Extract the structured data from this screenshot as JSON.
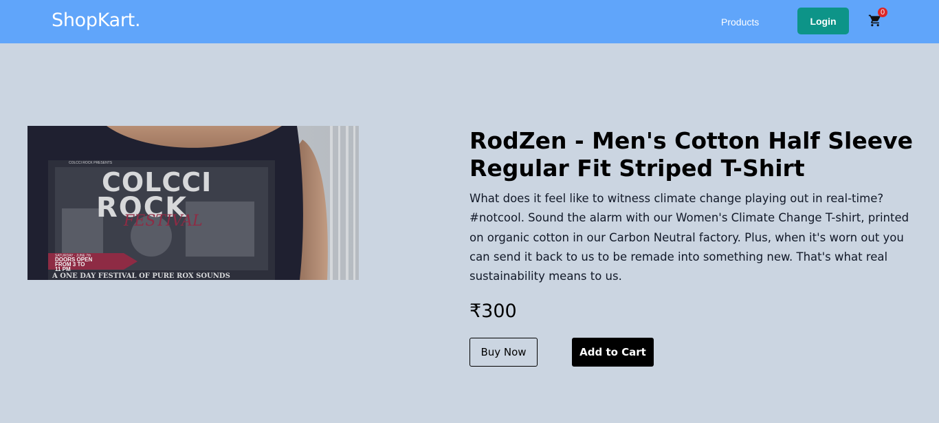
{
  "navbar": {
    "brand": "ShopKart.",
    "products_link": "Products",
    "login_label": "Login",
    "cart_count": "0",
    "cart_icon": "shopping-cart-icon",
    "bg_color": "#60a5fa",
    "login_color": "#0d9488",
    "badge_color": "#dc2626"
  },
  "product": {
    "image_alt_text": [
      "COLCCI",
      "ROCK",
      "FESTIVAL",
      "DOORS OPEN",
      "FROM 3 TO",
      "11 PM",
      "A ONE DAY FESTIVAL OF PURE ROX SOUNDS"
    ],
    "title": "RodZen - Men's Cotton Half Sleeve Regular Fit Striped T-Shirt",
    "description": "What does it feel like to witness climate change playing out in real-time? #notcool. Sound the alarm with our Women's Climate Change T-shirt, printed on organic cotton in our Carbon Neutral factory. Plus, when it's worn out you can send it back to us to be remade into something new. That's what real sustainability means to us.",
    "price": "₹300",
    "buy_now_label": "Buy Now",
    "add_to_cart_label": "Add to Cart"
  },
  "page": {
    "bg_color": "#cbd5e1"
  }
}
